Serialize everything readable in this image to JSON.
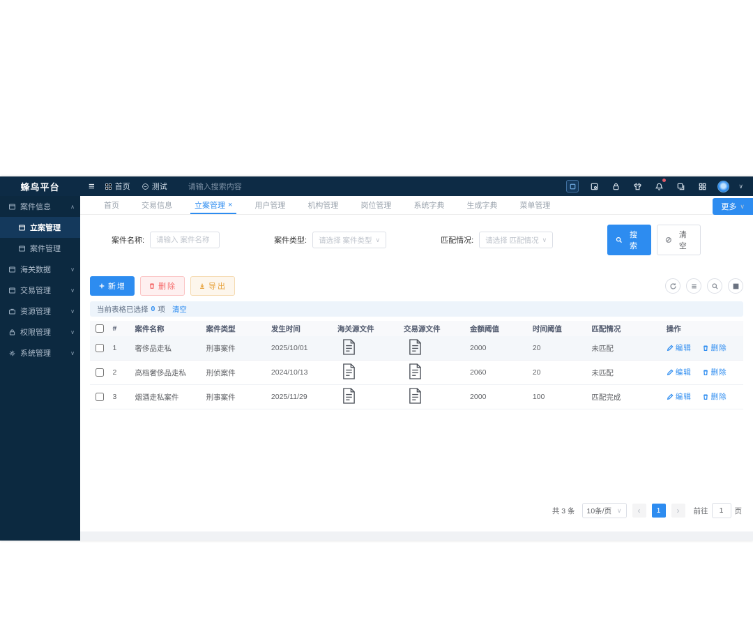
{
  "brand": {
    "title": "蜂鸟平台"
  },
  "topbar": {
    "menu_icon": "≡",
    "home_label": "首页",
    "test_label": "测试",
    "search_placeholder": "请输入搜索内容",
    "user_caret": "∨"
  },
  "sidebar": {
    "items": [
      {
        "label": "案件信息",
        "caret": "∧"
      },
      {
        "label": "立案管理"
      },
      {
        "label": "案件管理"
      },
      {
        "label": "海关数据",
        "caret": "∨"
      },
      {
        "label": "交易管理",
        "caret": "∨"
      },
      {
        "label": "资源管理",
        "caret": "∨"
      },
      {
        "label": "权限管理",
        "caret": "∨"
      },
      {
        "label": "系统管理",
        "caret": "∨"
      }
    ]
  },
  "tabbar": {
    "tabs": [
      {
        "label": "首页"
      },
      {
        "label": "交易信息"
      },
      {
        "label": "立案管理",
        "close": "×"
      },
      {
        "label": "用户管理"
      },
      {
        "label": "机构管理"
      },
      {
        "label": "岗位管理"
      },
      {
        "label": "系统字典"
      },
      {
        "label": "生成字典"
      },
      {
        "label": "菜单管理"
      }
    ],
    "more_label": "更多",
    "more_caret": "∨"
  },
  "filters": {
    "name_label": "案件名称:",
    "name_placeholder": "请输入 案件名称",
    "type_label": "案件类型:",
    "type_placeholder": "请选择 案件类型",
    "match_label": "匹配情况:",
    "match_placeholder": "请选择 匹配情况",
    "select_caret": "∨",
    "search_label": "搜索",
    "clear_label": "清空"
  },
  "toolbar": {
    "add_label": "新增",
    "delete_label": "删除",
    "export_label": "导出"
  },
  "selection_bar": {
    "prefix": "当前表格已选择",
    "count": "0",
    "suffix": "项",
    "clear_label": "清空"
  },
  "table": {
    "headers": [
      "#",
      "案件名称",
      "案件类型",
      "发生时间",
      "海关源文件",
      "交易源文件",
      "金额阈值",
      "时间阈值",
      "匹配情况",
      "操作"
    ],
    "edit_label": "编辑",
    "delete_label": "删除",
    "rows": [
      {
        "index": "1",
        "name": "奢侈品走私",
        "type": "刑事案件",
        "date": "2025/10/01",
        "amount": "2000",
        "time": "20",
        "match": "未匹配"
      },
      {
        "index": "2",
        "name": "高档奢侈品走私",
        "type": "刑侦案件",
        "date": "2024/10/13",
        "amount": "2060",
        "time": "20",
        "match": "未匹配"
      },
      {
        "index": "3",
        "name": "烟酒走私案件",
        "type": "刑事案件",
        "date": "2025/11/29",
        "amount": "2000",
        "time": "100",
        "match": "匹配完成"
      }
    ]
  },
  "pagination": {
    "total": "共 3 条",
    "page_size": "10条/页",
    "size_caret": "∨",
    "prev": "‹",
    "next": "›",
    "current_page": "1",
    "goto_prefix": "前往",
    "goto_value": "1",
    "goto_suffix": "页"
  },
  "colors": {
    "topbar_bg": "#0d2b45",
    "sidebar_bg": "#0c2940",
    "accent": "#2d8cf0",
    "danger": "#f56c6c",
    "warning": "#e6a23c",
    "selection_bar_bg": "#edf4fb"
  }
}
